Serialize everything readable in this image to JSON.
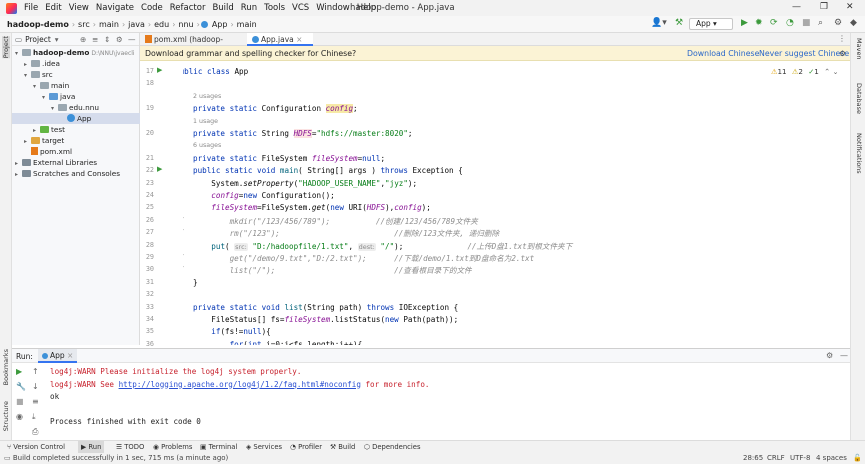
{
  "window": {
    "title": "hadoop-demo - App.java",
    "menus": [
      "File",
      "Edit",
      "View",
      "Navigate",
      "Code",
      "Refactor",
      "Build",
      "Run",
      "Tools",
      "VCS",
      "Window",
      "Help"
    ]
  },
  "breadcrumb": [
    "hadoop-demo",
    "src",
    "main",
    "java",
    "edu",
    "nnu",
    "App",
    "main"
  ],
  "toolbar": {
    "run_config": "App"
  },
  "project_panel": {
    "title": "Project",
    "tree": [
      {
        "label": "hadoop-demo",
        "extra": "D:\\NNU\\jvaecli",
        "icon": "folder",
        "depth": 0,
        "expanded": true
      },
      {
        "label": ".idea",
        "icon": "folder",
        "depth": 1,
        "expanded": false
      },
      {
        "label": "src",
        "icon": "folder",
        "depth": 1,
        "expanded": true
      },
      {
        "label": "main",
        "icon": "folder",
        "depth": 2,
        "expanded": true
      },
      {
        "label": "java",
        "icon": "source-folder",
        "depth": 3,
        "expanded": true
      },
      {
        "label": "edu.nnu",
        "icon": "package",
        "depth": 4,
        "expanded": true
      },
      {
        "label": "App",
        "icon": "class",
        "depth": 5,
        "selected": true
      },
      {
        "label": "test",
        "icon": "test-folder",
        "depth": 2,
        "expanded": false
      },
      {
        "label": "target",
        "icon": "target-folder",
        "depth": 1,
        "expanded": false
      },
      {
        "label": "pom.xml",
        "icon": "xml-file",
        "depth": 1
      },
      {
        "label": "External Libraries",
        "icon": "library",
        "depth": 0,
        "expanded": false
      },
      {
        "label": "Scratches and Consoles",
        "icon": "scratches",
        "depth": 0,
        "expanded": false
      }
    ]
  },
  "tabs": [
    {
      "label": "pom.xml (hadoop-demo)",
      "active": false
    },
    {
      "label": "App.java",
      "active": true
    }
  ],
  "banner": {
    "message": "Download grammar and spelling checker for Chinese?",
    "action1": "Download Chinese",
    "action2": "Never suggest Chinese"
  },
  "inspections": {
    "warnings": "11",
    "weak_warnings": "2",
    "typos": "1"
  },
  "editor": {
    "lines": [
      {
        "n": "17",
        "usage": "",
        "segs": [
          [
            "kw",
            "public class "
          ],
          [
            "",
            "App"
          ]
        ]
      },
      {
        "n": "18",
        "usage": "",
        "segs": [
          [
            "",
            "{"
          ]
        ]
      },
      {
        "n": "",
        "usage": "2 usages",
        "segs": []
      },
      {
        "n": "19",
        "usage": "",
        "segs": [
          [
            "kw",
            "private static "
          ],
          [
            "",
            "Configuration "
          ],
          [
            "fldw",
            "config"
          ],
          [
            "",
            ";"
          ]
        ]
      },
      {
        "n": "",
        "usage": "1 usage",
        "segs": []
      },
      {
        "n": "20",
        "usage": "",
        "segs": [
          [
            "kw",
            "private static "
          ],
          [
            "",
            "String "
          ],
          [
            "cnstbox",
            "HDFS"
          ],
          [
            "",
            "="
          ],
          [
            "str",
            "\"hdfs://master:8020\""
          ],
          [
            "",
            ";"
          ]
        ]
      },
      {
        "n": "",
        "usage": "6 usages",
        "segs": []
      },
      {
        "n": "21",
        "usage": "",
        "segs": [
          [
            "kw",
            "private static "
          ],
          [
            "",
            "FileSystem "
          ],
          [
            "fld",
            "fileSystem"
          ],
          [
            "",
            "="
          ],
          [
            "kw",
            "null"
          ],
          [
            "",
            ";"
          ]
        ]
      },
      {
        "n": "22",
        "usage": "",
        "segs": [
          [
            "kw",
            "public static void "
          ],
          [
            "mth",
            "main"
          ],
          [
            "",
            "( String[] args ) "
          ],
          [
            "kw",
            "throws "
          ],
          [
            "",
            "Exception {"
          ]
        ]
      },
      {
        "n": "23",
        "usage": "",
        "segs": [
          [
            "",
            "    System."
          ],
          [
            "smth",
            "setProperty"
          ],
          [
            "",
            "("
          ],
          [
            "str",
            "\"HADOOP_USER_NAME\""
          ],
          [
            "",
            ","
          ],
          [
            "str",
            "\"jyz\""
          ],
          [
            "",
            ");"
          ]
        ]
      },
      {
        "n": "24",
        "usage": "",
        "segs": [
          [
            "",
            "    "
          ],
          [
            "fld",
            "config"
          ],
          [
            "",
            "="
          ],
          [
            "kw",
            "new "
          ],
          [
            "",
            "Configuration();"
          ]
        ]
      },
      {
        "n": "25",
        "usage": "",
        "segs": [
          [
            "",
            "    "
          ],
          [
            "fld",
            "fileSystem"
          ],
          [
            "",
            "=FileSystem."
          ],
          [
            "smth",
            "get"
          ],
          [
            "",
            "("
          ],
          [
            "kw",
            "new "
          ],
          [
            "",
            "URI("
          ],
          [
            "cnst",
            "HDFS"
          ],
          [
            "",
            "),"
          ],
          [
            "fld",
            "config"
          ],
          [
            "",
            ");"
          ]
        ]
      },
      {
        "n": "26",
        "usage": "",
        "comment": true,
        "segs": [
          [
            "cmt",
            "        mkdir(\"/123/456/789\");          //创建/123/456/789文件夹"
          ]
        ]
      },
      {
        "n": "27",
        "usage": "",
        "comment": true,
        "segs": [
          [
            "cmt",
            "        rm(\"/123\");                         //删除/123文件夹, 递归删除"
          ]
        ]
      },
      {
        "n": "28",
        "usage": "",
        "segs": [
          [
            "",
            "    "
          ],
          [
            "mth",
            "put"
          ],
          [
            "",
            "( "
          ],
          [
            "hint",
            "src:"
          ],
          [
            "",
            ""
          ],
          [
            "str",
            " \"D:/hadoopfile/1.txt\""
          ],
          [
            "",
            ", "
          ],
          [
            "hint",
            "dest:"
          ],
          [
            "str",
            " \"/\""
          ],
          [
            "",
            ");              "
          ],
          [
            "cmt",
            "//上传D盘1.txt到根文件夹下"
          ]
        ]
      },
      {
        "n": "29",
        "usage": "",
        "comment": true,
        "segs": [
          [
            "cmt",
            "        get(\"/demo/9.txt\",\"D:/2.txt\");      //下载/demo/1.txt到D盘命名为2.txt"
          ]
        ]
      },
      {
        "n": "30",
        "usage": "",
        "comment": true,
        "segs": [
          [
            "cmt",
            "        list(\"/\");                          //查看根目录下的文件"
          ]
        ]
      },
      {
        "n": "31",
        "usage": "",
        "segs": [
          [
            "",
            "}"
          ]
        ]
      },
      {
        "n": "32",
        "usage": "",
        "segs": []
      },
      {
        "n": "33",
        "usage": "",
        "segs": [
          [
            "kw",
            "private static void "
          ],
          [
            "mth",
            "list"
          ],
          [
            "",
            "(String path) "
          ],
          [
            "kw",
            "throws "
          ],
          [
            "",
            "IOException {"
          ]
        ]
      },
      {
        "n": "34",
        "usage": "",
        "segs": [
          [
            "",
            "    FileStatus[] fs="
          ],
          [
            "fld",
            "fileSystem"
          ],
          [
            "",
            ".listStatus("
          ],
          [
            "kw",
            "new "
          ],
          [
            "",
            "Path(path));"
          ]
        ]
      },
      {
        "n": "35",
        "usage": "",
        "segs": [
          [
            "",
            "    "
          ],
          [
            "kw",
            "if"
          ],
          [
            "",
            "(fs!="
          ],
          [
            "kw",
            "null"
          ],
          [
            "",
            "){"
          ]
        ]
      },
      {
        "n": "36",
        "usage": "",
        "segs": [
          [
            "",
            "        "
          ],
          [
            "kw",
            "for"
          ],
          [
            "",
            "("
          ],
          [
            "kw",
            "int "
          ],
          [
            "",
            "i=0;i<fs.length;i++){"
          ]
        ]
      }
    ]
  },
  "run_panel": {
    "label": "Run:",
    "tab": "App",
    "console": [
      {
        "kind": "warn",
        "text": "log4j:WARN Please initialize the log4j system properly."
      },
      {
        "kind": "warn-link",
        "pre": "log4j:WARN See ",
        "link": "http://logging.apache.org/log4j/1.2/faq.html#noconfig",
        "post": " for more info."
      },
      {
        "kind": "plain",
        "text": "ok"
      },
      {
        "kind": "blank",
        "text": ""
      },
      {
        "kind": "plain",
        "text": "Process finished with exit code 0"
      }
    ]
  },
  "tool_windows": [
    "Version Control",
    "Run",
    "TODO",
    "Problems",
    "Terminal",
    "Services",
    "Profiler",
    "Build",
    "Dependencies"
  ],
  "side_tools": {
    "left": [
      "Project",
      "Bookmarks",
      "Structure"
    ],
    "right": [
      "Maven",
      "Database",
      "Notifications"
    ]
  },
  "status": {
    "message": "Build completed successfully in 1 sec, 715 ms (a minute ago)",
    "position": "28:65",
    "line_sep": "CRLF",
    "encoding": "UTF-8",
    "indent": "4 spaces"
  }
}
